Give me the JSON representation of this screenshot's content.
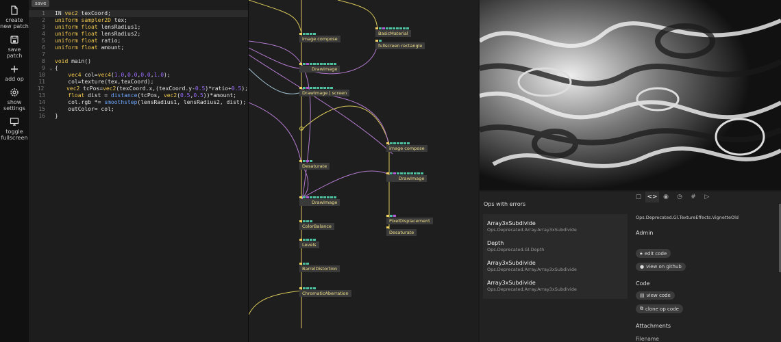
{
  "sidebar": {
    "items": [
      {
        "icon": "file-icon",
        "label": "create new patch"
      },
      {
        "icon": "save-icon",
        "label": "save patch"
      },
      {
        "icon": "plus-icon",
        "label": "add op"
      },
      {
        "icon": "gear-icon",
        "label": "show settings"
      },
      {
        "icon": "monitor-icon",
        "label": "toggle fullscreen"
      }
    ]
  },
  "editor": {
    "save_label": "save",
    "lines": [
      {
        "n": "1",
        "fold": "",
        "html": "IN <span class='kw'>vec2</span> texCoord;"
      },
      {
        "n": "2",
        "fold": "",
        "html": "<span class='kw'>uniform</span> <span class='kw'>sampler2D</span> tex;"
      },
      {
        "n": "3",
        "fold": "",
        "html": "<span class='kw'>uniform</span> <span class='kw'>float</span> lensRadius1;"
      },
      {
        "n": "4",
        "fold": "",
        "html": "<span class='kw'>uniform</span> <span class='kw'>float</span> lensRadius2;"
      },
      {
        "n": "5",
        "fold": "",
        "html": "<span class='kw'>uniform</span> <span class='kw'>float</span> ratio;"
      },
      {
        "n": "6",
        "fold": "",
        "html": "<span class='kw'>uniform</span> <span class='kw'>float</span> amount;"
      },
      {
        "n": "7",
        "fold": "",
        "html": ""
      },
      {
        "n": "8",
        "fold": "",
        "html": "<span class='kw'>void</span> main()"
      },
      {
        "n": "9",
        "fold": "⌄",
        "html": "{"
      },
      {
        "n": "10",
        "fold": "",
        "html": "    <span class='kw'>vec4</span> col=<span class='kw'>vec4</span>(<span class='num'>1.0</span>,<span class='num'>0.0</span>,<span class='num'>0.0</span>,<span class='num'>1.0</span>);"
      },
      {
        "n": "11",
        "fold": "",
        "html": "    col=texture(tex,texCoord);"
      },
      {
        "n": "12",
        "fold": "",
        "html": "    <span class='kw'>vec2</span> tcPos=<span class='kw'>vec2</span>(texCoord.x,(texCoord.y-<span class='num'>0.5</span>)*ratio+<span class='num'>0.5</span>);"
      },
      {
        "n": "13",
        "fold": "",
        "html": "    <span class='kw'>float</span> dist = <span class='fn'>distance</span>(tcPos, <span class='kw'>vec2</span>(<span class='num'>0.5</span>,<span class='num'>0.5</span>))*amount;"
      },
      {
        "n": "14",
        "fold": "",
        "html": "    col.rgb *= <span class='fn'>smoothstep</span>(lensRadius1, lensRadius2, dist);"
      },
      {
        "n": "15",
        "fold": "",
        "html": "    outColor= col;"
      },
      {
        "n": "16",
        "fold": "",
        "html": "}"
      }
    ]
  },
  "patch": {
    "ops": [
      {
        "label": "image compose"
      },
      {
        "label": "BasicMaterial"
      },
      {
        "label": "fullscreen rectangle"
      },
      {
        "label": "DrawImage"
      },
      {
        "label": "DrawImage | screen"
      },
      {
        "label": "image compose"
      },
      {
        "label": "Desaturate"
      },
      {
        "label": "DrawImage"
      },
      {
        "label": "DrawImage"
      },
      {
        "label": "PixelDisplacement"
      },
      {
        "label": "Desaturate"
      },
      {
        "label": "ColorBalance"
      },
      {
        "label": "Levels"
      },
      {
        "label": "BarrelDistortion"
      },
      {
        "label": "ChromaticAberration"
      }
    ]
  },
  "errors": {
    "title": "Ops with errors",
    "items": [
      {
        "name": "Array3xSubdivide",
        "path": "Ops.Deprecated.Array.Array3xSubdivide"
      },
      {
        "name": "Depth",
        "path": "Ops.Deprecated.Gl.Depth"
      },
      {
        "name": "Array3xSubdivide",
        "path": "Ops.Deprecated.Array.Array3xSubdivide"
      },
      {
        "name": "Array3xSubdivide",
        "path": "Ops.Deprecated.Array.Array3xSubdivide"
      }
    ]
  },
  "info": {
    "tabs": [
      {
        "icon": "book-icon",
        "glyph": "▢"
      },
      {
        "icon": "code-icon",
        "glyph": "<>"
      },
      {
        "icon": "eye-icon",
        "glyph": "◉"
      },
      {
        "icon": "clock-icon",
        "glyph": "◷"
      },
      {
        "icon": "hash-icon",
        "glyph": "#"
      },
      {
        "icon": "play-icon",
        "glyph": "▷"
      }
    ],
    "namespace": "Ops.Deprecated.Gl.TextureEffects.VignetteOld",
    "admin_title": "Admin",
    "edit_code": "edit code",
    "view_github": "view on github",
    "code_title": "Code",
    "view_code": "view code",
    "clone_code": "clone op code",
    "attachments_title": "Attachments",
    "filename": "Filename"
  }
}
